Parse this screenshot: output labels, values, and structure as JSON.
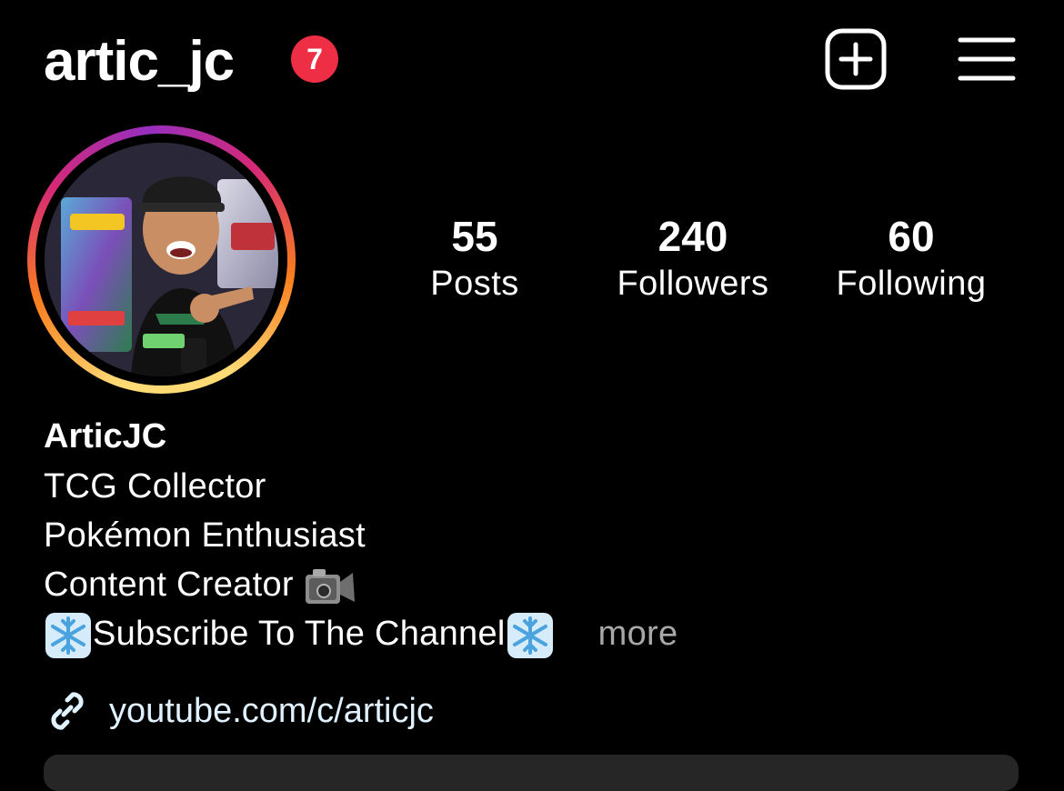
{
  "header": {
    "username": "artic_jc",
    "notification_count": "7",
    "create_icon": "plus-square-icon",
    "menu_icon": "hamburger-menu-icon"
  },
  "profile": {
    "avatar_icon": "profile-photo",
    "story_ring_colors": [
      "#feda75",
      "#fa7e1e",
      "#d62976",
      "#962fbf"
    ]
  },
  "stats": [
    {
      "value": "55",
      "label": "Posts"
    },
    {
      "value": "240",
      "label": "Followers"
    },
    {
      "value": "60",
      "label": "Following"
    }
  ],
  "bio": {
    "name": "ArticJC",
    "lines": [
      "TCG Collector",
      "Pokémon Enthusiast",
      "Content Creator"
    ],
    "subscribe_text": "Subscribe To The Channel",
    "more": "more",
    "camera_icon": "video-camera-icon",
    "snowflake_icon": "snowflake-icon"
  },
  "link": {
    "icon": "link-icon",
    "text": "youtube.com/c/articjc"
  },
  "colors": {
    "background": "#000000",
    "badge": "#ed2e44",
    "link": "#e0f1ff",
    "muted": "#a8a8a8"
  }
}
